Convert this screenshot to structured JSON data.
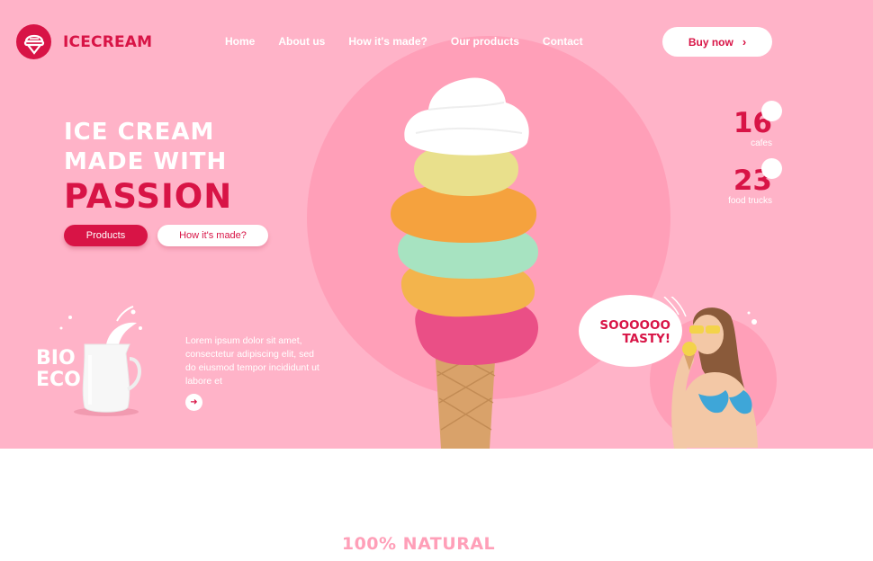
{
  "brand": {
    "name": "ICECREAM",
    "color": "#d81446"
  },
  "colors": {
    "hero_bg": "#ffb3c8",
    "circle": "#ff9fb8",
    "accent": "#d81446",
    "white": "#ffffff"
  },
  "nav": {
    "items": [
      {
        "label": "Home"
      },
      {
        "label": "About us"
      },
      {
        "label": "How it's made?"
      },
      {
        "label": "Our products"
      },
      {
        "label": "Contact"
      }
    ],
    "buy_label": "Buy now",
    "buy_icon": "chevron-right-icon"
  },
  "hero": {
    "line1": "ICE CREAM",
    "line2": "MADE WITH",
    "line3": "PASSION",
    "products_button": "Products",
    "how_button": "How it's made?"
  },
  "stats": [
    {
      "value": "16",
      "label": "cafes"
    },
    {
      "value": "23",
      "label": "food trucks"
    }
  ],
  "bio": {
    "text1": "BIO",
    "text2": "ECO",
    "description": "Lorem ipsum dolor sit amet, consectetur adipiscing elit, sed do eiusmod tempor incididunt ut labore et",
    "arrow_icon": "arrow-right-icon"
  },
  "bubble": {
    "line1": "SOOOOOO",
    "line2": "TASTY!"
  },
  "section": {
    "title": "100% NATURAL"
  }
}
